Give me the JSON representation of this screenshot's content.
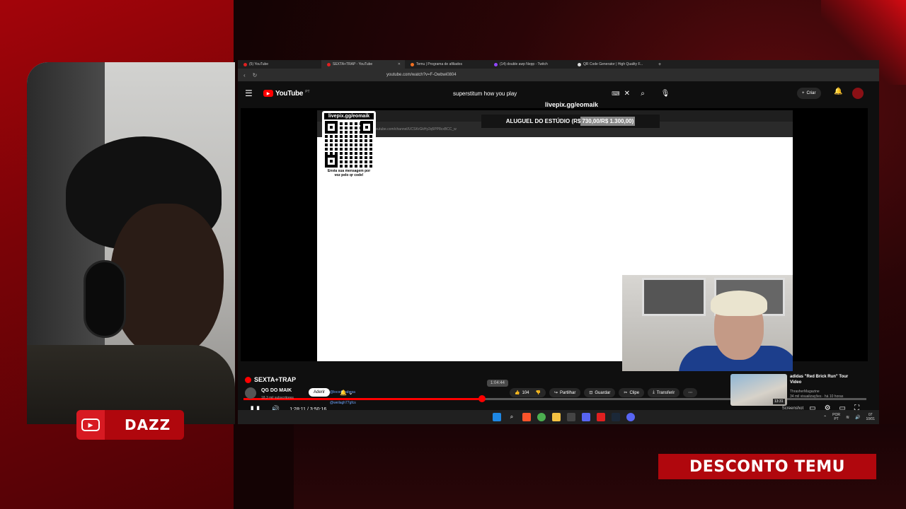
{
  "overlay": {
    "channel_name": "DAZZ",
    "promo_text": "DESCONTO TEMU"
  },
  "browser": {
    "tabs": [
      {
        "label": "(5) YouTube",
        "icon": "youtube-icon"
      },
      {
        "label": "SEXTA+TRAP - YouTube",
        "icon": "youtube-icon"
      },
      {
        "label": "Temu | Programa de afiliados",
        "icon": "temu-icon"
      },
      {
        "label": "(14) double awp Nepp - Twitch",
        "icon": "twitch-icon"
      },
      {
        "label": "QR Code Generator | High Quality F...",
        "icon": "qr-icon"
      }
    ],
    "url": "youtube.com/watch?v=F-Owbwi0804"
  },
  "youtube": {
    "logo_text": "YouTube",
    "logo_region": "PT",
    "search_query": "superstitum how you play",
    "create_label": "Criar",
    "video": {
      "livepix_label": "livepix.gg/eomaik",
      "rent_text_prefix": "ALUGUEL DO ESTÚDIO (R$ ",
      "rent_text_value": "730,00/R$ 1.300,00)",
      "qr_title": "livepix.gg/eomaik",
      "qr_caption": "Envia sua mensagem por voz pelo qr code!",
      "inner_url": "youtube.com/channel/UCSKrGkHy2q5PP8cxBCC_w",
      "hover_time": "1:04:44",
      "mentions": [
        "@locodakabesa",
        "@weilagh77gfcs"
      ],
      "current_time": "1:28:11",
      "total_time": "3:50:16",
      "time_display": "1:28:11 / 3:50:16",
      "progress": 0.383,
      "screenshot_label": "Screenshot"
    },
    "title": "SEXTA+TRAP",
    "channel": {
      "name": "QG DO MAIK",
      "subscribers": "18,3 mil subscritores",
      "join_label": "Aderir"
    },
    "actions": {
      "likes": "104",
      "share": "Partilhar",
      "save": "Guardar",
      "clip": "Clipe",
      "download": "Transferir"
    },
    "recommended": {
      "title": "adidas \"Red Brick Run\" Tour Video",
      "channel": "ThrasherMagazine",
      "meta": "34 mil visualizações · há 10 horas",
      "duration": "13:31"
    }
  },
  "taskbar": {
    "lang": "POR",
    "region": "PT",
    "clock_time": "07",
    "clock_date": "10/01"
  }
}
